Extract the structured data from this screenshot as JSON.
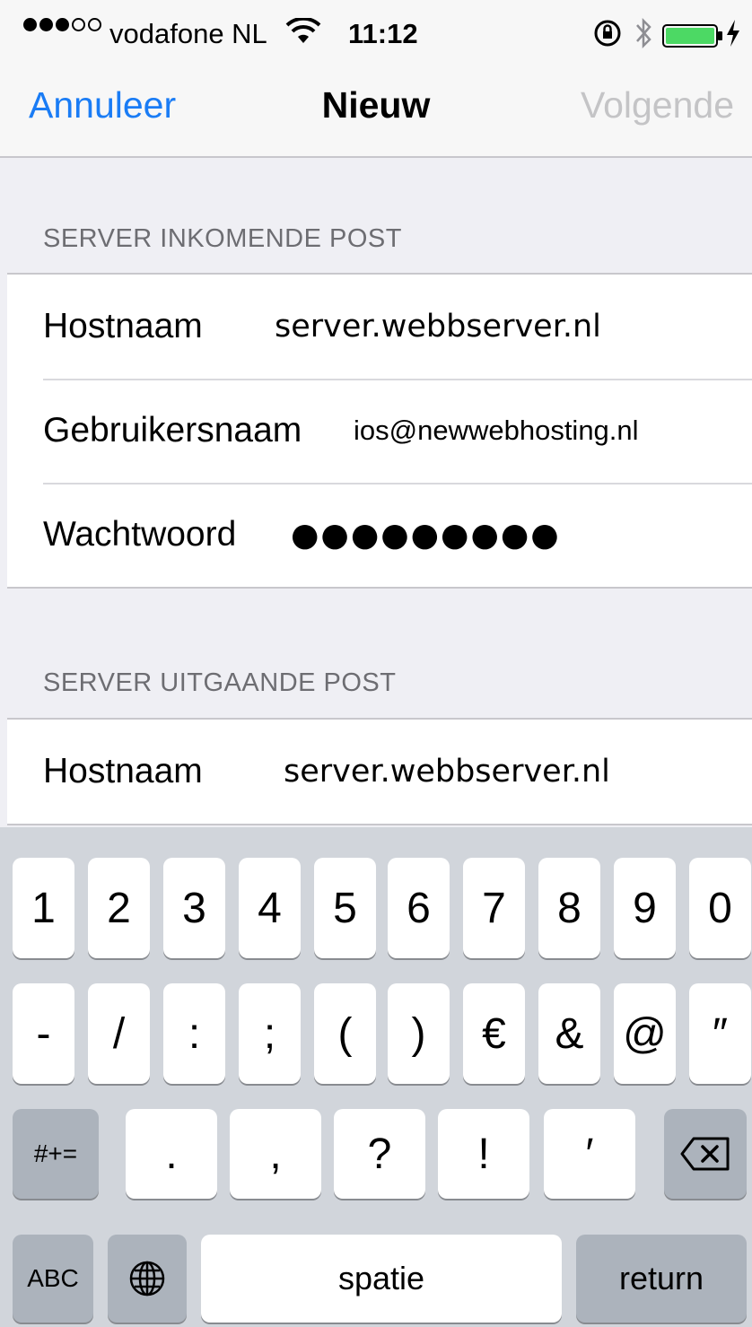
{
  "status_bar": {
    "carrier": "vodafone NL",
    "time": "11:12",
    "signal_bars_filled": 3,
    "signal_bars_total": 5
  },
  "nav": {
    "cancel_label": "Annuleer",
    "title": "Nieuw",
    "next_label": "Volgende"
  },
  "incoming": {
    "header": "SERVER INKOMENDE POST",
    "rows": [
      {
        "label": "Hostnaam",
        "value": "server.webbserver.nl"
      },
      {
        "label": "Gebruikersnaam",
        "value": "ios@newwebhosting.nl"
      },
      {
        "label": "Wachtwoord",
        "value": "●●●●●●●●●"
      }
    ]
  },
  "outgoing": {
    "header": "SERVER UITGAANDE POST",
    "rows": [
      {
        "label": "Hostnaam",
        "value": "server.webbserver.nl"
      }
    ]
  },
  "keyboard": {
    "row1": [
      "1",
      "2",
      "3",
      "4",
      "5",
      "6",
      "7",
      "8",
      "9",
      "0"
    ],
    "row2": [
      "-",
      "/",
      ":",
      ";",
      "(",
      ")",
      "€",
      "&",
      "@",
      "″"
    ],
    "row3_mode": "#+=",
    "row3": [
      ".",
      ",",
      "?",
      "!",
      "′"
    ],
    "abc_label": "ABC",
    "space_label": "spatie",
    "return_label": "return"
  },
  "colors": {
    "accent": "#1a7cf5",
    "disabled": "#c4c4c6",
    "battery": "#4cd964"
  }
}
